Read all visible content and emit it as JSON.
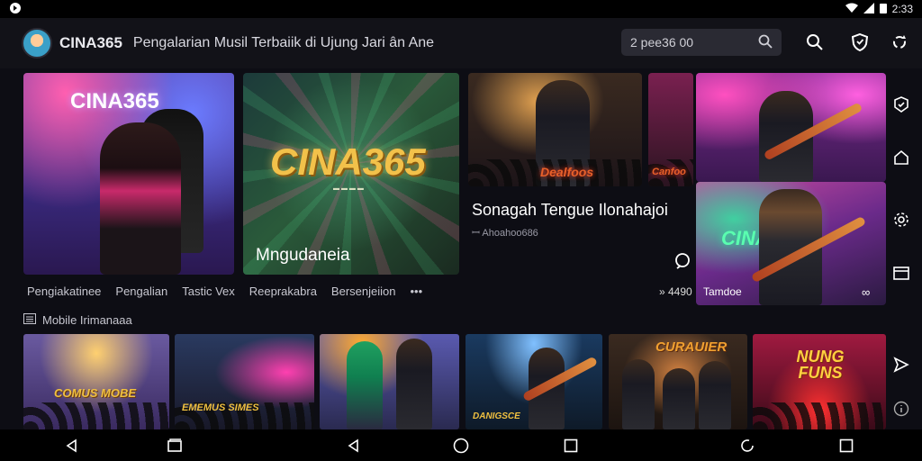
{
  "status_bar": {
    "time": "2:33"
  },
  "header": {
    "brand": "CINA365",
    "tagline": "Pengalarian Musil Terbaiik di Ujung Jari ân Ane",
    "search_value": "2 pee36 00"
  },
  "hero": {
    "card1_title": "CINA365",
    "card2_logo": "CINA365",
    "card2_caption": "Mngudaneia",
    "card3_neon": "Dealfoos",
    "card3b_neon": "Canfoo",
    "card5_neon": "CINAST",
    "featured_title": "Sonagah Tengue Ilonahajoi",
    "featured_meta": "ꟷ Ahoahoo686",
    "count": "» 4490",
    "tile_label": "Tamdoe"
  },
  "tabs": [
    "Pengiakatinee",
    "Pengalian",
    "Tastic Vex",
    "Reeprakabra",
    "Bersenjeiion",
    "•••"
  ],
  "section": {
    "title": "Mobile Irimanaaa"
  },
  "thumbnails": [
    {
      "label": "COMUS MOBE"
    },
    {
      "label": "EMEMUS SIMES"
    },
    {
      "label": ""
    },
    {
      "label": "DANIGSCE"
    },
    {
      "label": "CURAUIER"
    },
    {
      "label": "NUNG FUNS"
    }
  ],
  "colors": {
    "background": "#0d0d14",
    "topbar": "#121218",
    "accent_gold": "#f2c14a",
    "neon_red": "#e8602a"
  }
}
